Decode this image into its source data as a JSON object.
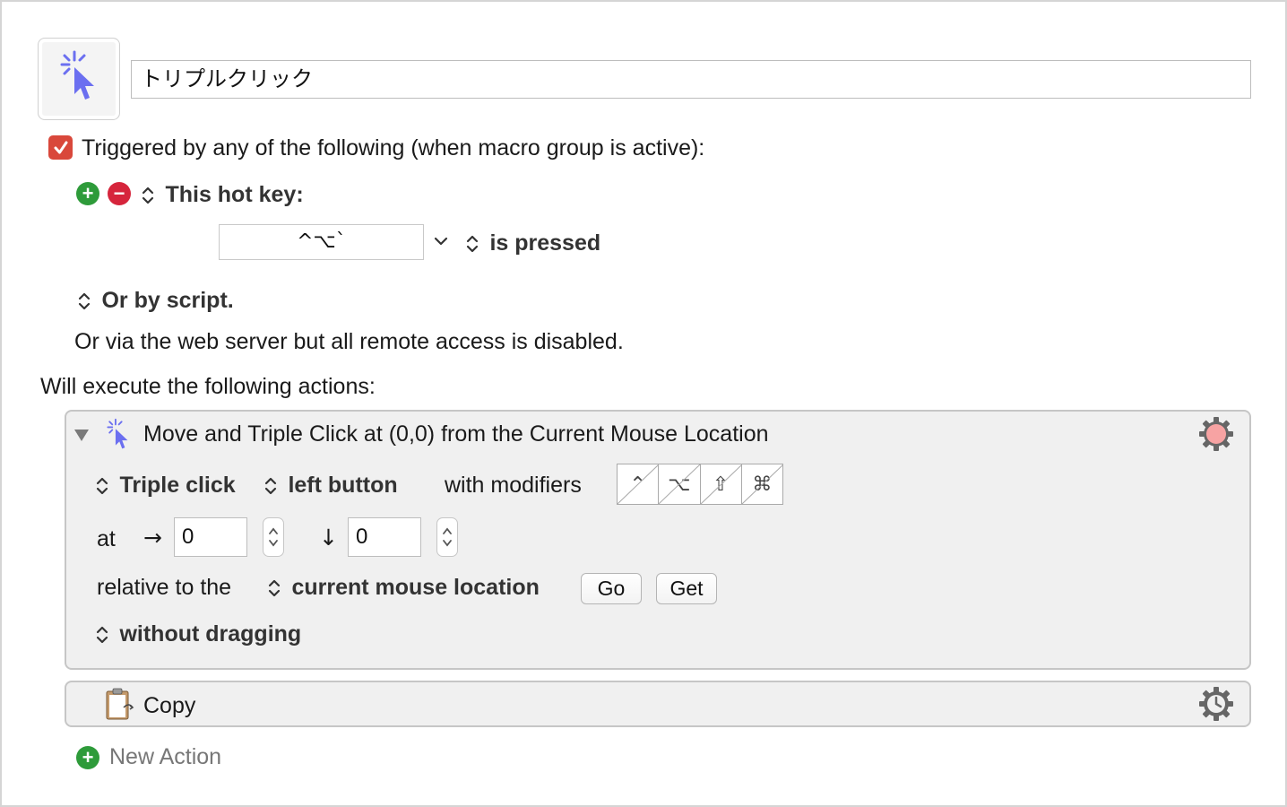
{
  "macro": {
    "name": "トリプルクリック",
    "icon": "cursor-click-icon"
  },
  "trigger": {
    "enabled": true,
    "heading": "Triggered by any of the following (when macro group is active):",
    "type_label": "This hot key:",
    "hotkey_value": "^⌥`",
    "condition_label": "is pressed",
    "script_label": "Or by script.",
    "webserver_text": "Or via the web server but all remote access is disabled."
  },
  "actions_heading": "Will execute the following actions:",
  "actions": [
    {
      "title": "Move and Triple Click at (0,0) from the Current Mouse Location",
      "expanded": true,
      "click_type": "Triple click",
      "button": "left button",
      "modifiers_label": "with modifiers",
      "modifiers": [
        "⌃",
        "⌥",
        "⇧",
        "⌘"
      ],
      "at_label": "at",
      "x_arrow": "→",
      "x_value": "0",
      "y_arrow": "↓",
      "y_value": "0",
      "relative_label": "relative to the",
      "relative_to": "current mouse location",
      "go_label": "Go",
      "get_label": "Get",
      "drag_label": "without dragging",
      "gear_status_color": "#f7a3a3"
    },
    {
      "title": "Copy",
      "icon": "clipboard-icon"
    }
  ],
  "new_action_label": "New Action",
  "colors": {
    "checkbox": "#d9483b",
    "add": "#2e9b3a",
    "remove": "#d6253c",
    "cursor_icon": "#6b6ff0"
  }
}
